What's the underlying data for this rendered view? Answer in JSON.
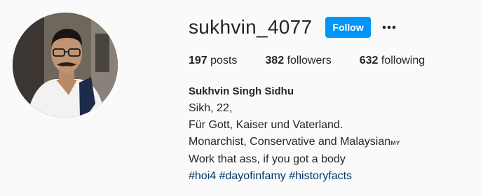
{
  "profile": {
    "username": "sukhvin_4077",
    "follow_label": "Follow",
    "more_icon": "more-options-icon",
    "stats": {
      "posts_count": "197",
      "posts_label": "posts",
      "followers_count": "382",
      "followers_label": "followers",
      "following_count": "632",
      "following_label": "following"
    },
    "full_name": "Sukhvin Singh Sidhu",
    "bio_lines": [
      "Sikh, 22,",
      "Für Gott, Kaiser und Vaterland.",
      "Monarchist, Conservative and Malaysian",
      "Work that ass, if you got a body"
    ],
    "bio_line3_suffix": "ᴍʏ",
    "hashtags": [
      "#hoi4",
      "#dayofinfamy",
      "#historyfacts"
    ]
  },
  "colors": {
    "follow_button": "#0095f6",
    "hashtag": "#00376b",
    "background": "#fafafa",
    "text": "#262626"
  }
}
